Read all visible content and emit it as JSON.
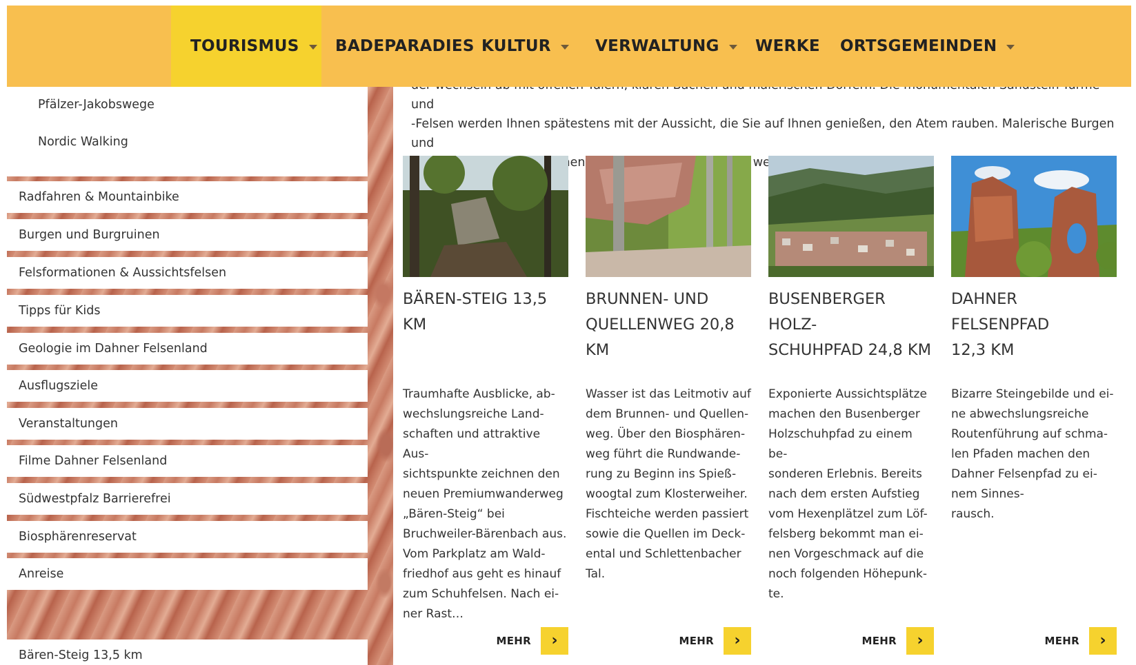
{
  "nav": {
    "items": [
      {
        "label": "TOURISMUS",
        "dropdown": true,
        "active": true
      },
      {
        "label": "BADEPARADIES",
        "dropdown": false
      },
      {
        "label": "KULTUR",
        "dropdown": true
      },
      {
        "label": "VERWALTUNG",
        "dropdown": true
      },
      {
        "label": "WERKE",
        "dropdown": false
      },
      {
        "label": "ORTSGEMEINDEN",
        "dropdown": true
      }
    ],
    "bg_color": "#f8bf4f",
    "active_color": "#f6d22e"
  },
  "intro": {
    "line1": "der wechseln ab mit offenen Tälern, klaren Bächen und malerischen Dörfern. Die monumentalen Sandstein-Türme und",
    "line2": "-Felsen werden Ihnen spätestens mit der Aussicht, die Sie auf Ihnen genießen, den Atem rauben. Malerische Burgen und",
    "line3": "sagenumwobene Burgruinen warten darauf entdeckt zu werden."
  },
  "sidebar": {
    "sub_links": [
      "Pfälzer-Jakobswege",
      "Nordic Walking"
    ],
    "items": [
      "Radfahren & Mountainbike",
      "Burgen und Burgruinen",
      "Felsformationen & Aussichtsfelsen",
      "Tipps für Kids",
      "Geologie im Dahner Felsenland",
      "Ausflugsziele",
      "Veranstaltungen",
      "Filme Dahner Felsenland",
      "Südwestpfalz Barrierefrei",
      "Biosphärenreservat",
      "Anreise",
      "Bären-Steig 13,5 km"
    ]
  },
  "cards": [
    {
      "title_lines": [
        "BÄREN-STEIG 13,5 KM"
      ],
      "text_lines": [
        "Traumhafte Ausblicke, ab-",
        "wechslungsreiche Land-",
        "schaften und attraktive Aus-",
        "sichtspunkte zeichnen den",
        "neuen Premiumwanderweg",
        "„Bären-Steig“ bei",
        "Bruchweiler-Bärenbach aus.",
        "Vom Parkplatz am Wald-",
        "friedhof aus geht es hinauf",
        "zum Schuhfelsen. Nach ei-",
        "ner Rast…"
      ],
      "more_label": "MEHR"
    },
    {
      "title_lines": [
        "BRUNNEN- UND",
        "QUELLENWEG 20,8",
        "KM"
      ],
      "text_lines": [
        "Wasser ist das Leitmotiv auf",
        "dem Brunnen- und Quellen-",
        "weg. Über den Biosphären-",
        "weg führt die Rundwande-",
        "rung zu Beginn ins Spieß-",
        "woogtal zum Klosterweiher.",
        "Fischteiche werden passiert",
        "sowie die Quellen im Deck-",
        "ental und Schlettenbacher",
        "Tal."
      ],
      "more_label": "MEHR"
    },
    {
      "title_lines": [
        "BUSENBERGER HOLZ-",
        "SCHUHPFAD 24,8 KM"
      ],
      "text_lines": [
        "Exponierte Aussichtsplätze",
        "machen den Busenberger",
        "Holzschuhpfad zu einem be-",
        "sonderen Erlebnis. Bereits",
        "nach dem ersten Aufstieg",
        "vom Hexenplätzel zum Löf-",
        "felsberg bekommt man ei-",
        "nen Vorgeschmack auf die",
        "noch folgenden Höhepunk-",
        "te."
      ],
      "more_label": "MEHR"
    },
    {
      "title_lines": [
        "DAHNER FELSENPFAD",
        "12,3 KM"
      ],
      "text_lines": [
        "Bizarre Steingebilde und ei-",
        "ne abwechslungsreiche",
        "Routenführung  auf schma-",
        "len Pfaden machen den",
        "Dahner Felsenpfad zu ei-",
        "nem Sinnes-",
        "rausch."
      ],
      "more_label": "MEHR"
    }
  ],
  "icons": {
    "dropdown": "chevron-down-icon",
    "more": "chevron-right-icon"
  }
}
